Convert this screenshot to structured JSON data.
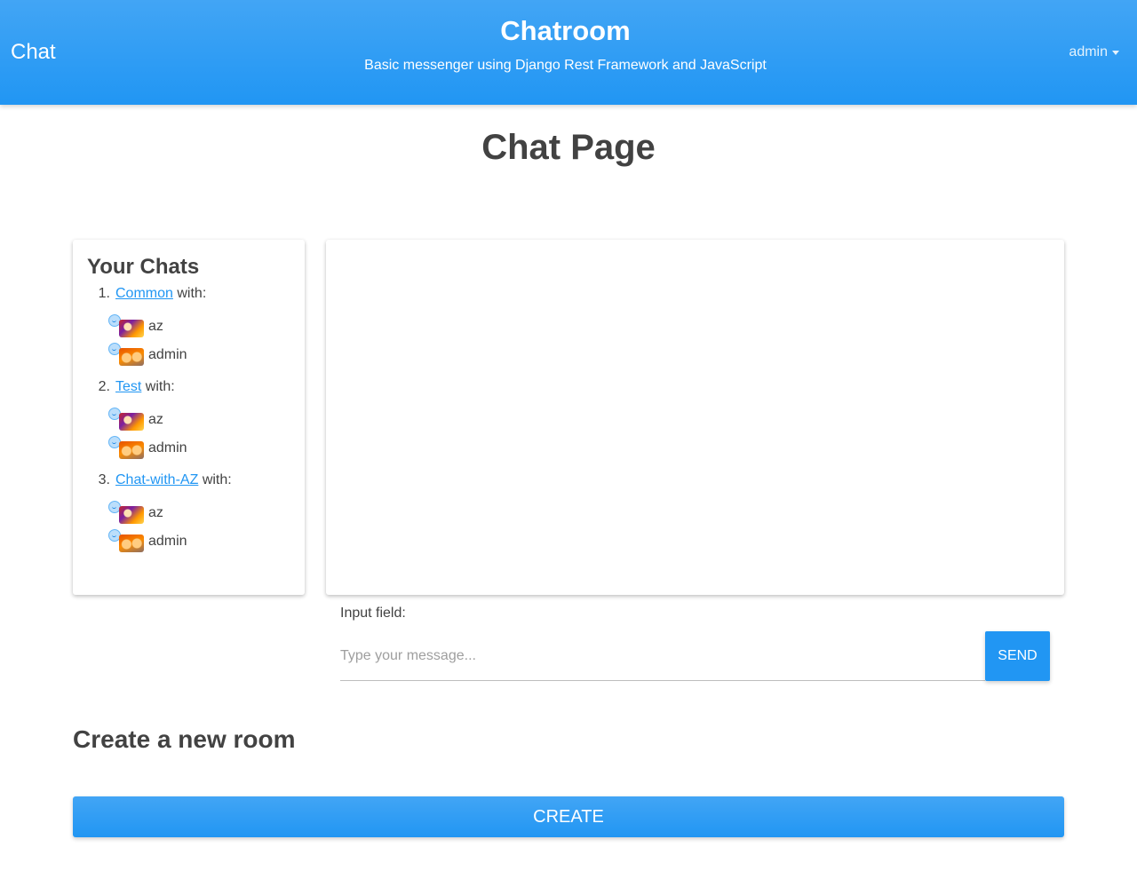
{
  "navbar": {
    "brand": "Chat",
    "title": "Chatroom",
    "subtitle": "Basic messenger using Django Rest Framework and JavaScript",
    "user_menu": "admin",
    "caret_icon": "caret-down-icon",
    "background": "#2196f3"
  },
  "page": {
    "title": "Chat Page"
  },
  "chats": {
    "heading": "Your Chats",
    "rooms": [
      {
        "number": "1.",
        "name": "Common",
        "suffix": "with:",
        "members": [
          {
            "name": "az",
            "avatar": "warrior-avatar"
          },
          {
            "name": "admin",
            "avatar": "fox-avatar"
          }
        ]
      },
      {
        "number": "2.",
        "name": "Test",
        "suffix": "with:",
        "members": [
          {
            "name": "az",
            "avatar": "warrior-avatar"
          },
          {
            "name": "admin",
            "avatar": "fox-avatar"
          }
        ]
      },
      {
        "number": "3.",
        "name": "Chat-with-AZ",
        "suffix": "with:",
        "members": [
          {
            "name": "az",
            "avatar": "warrior-avatar"
          },
          {
            "name": "admin",
            "avatar": "fox-avatar"
          }
        ]
      }
    ]
  },
  "composer": {
    "label": "Input field:",
    "value": "",
    "placeholder": "Type your message...",
    "send_label": "Send"
  },
  "create_room": {
    "heading": "Create a new room",
    "button_label": "Create"
  },
  "colors": {
    "accent": "#2196f3",
    "link": "#2196f3",
    "text": "#424242"
  }
}
